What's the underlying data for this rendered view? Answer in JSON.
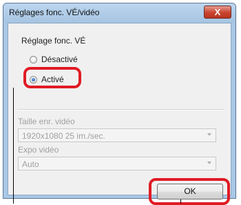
{
  "window": {
    "title": "Réglages fonc. VÉ/vidéo",
    "close_label": "X",
    "close_icon": "close-icon"
  },
  "group": {
    "heading": "Réglage fonc. VÉ",
    "options": [
      {
        "label": "Désactivé",
        "selected": false
      },
      {
        "label": "Activé",
        "selected": true
      }
    ]
  },
  "video_size": {
    "label": "Taille enr. vidéo",
    "value": "1920x1080  25 im./sec.",
    "enabled": false
  },
  "video_exposure": {
    "label": "Expo vidéo",
    "value": "Auto",
    "enabled": false
  },
  "buttons": {
    "ok_label": "OK"
  },
  "colors": {
    "highlight": "#e01b24",
    "title_bar": "#a9c8e6",
    "close_button": "#c8442f"
  }
}
